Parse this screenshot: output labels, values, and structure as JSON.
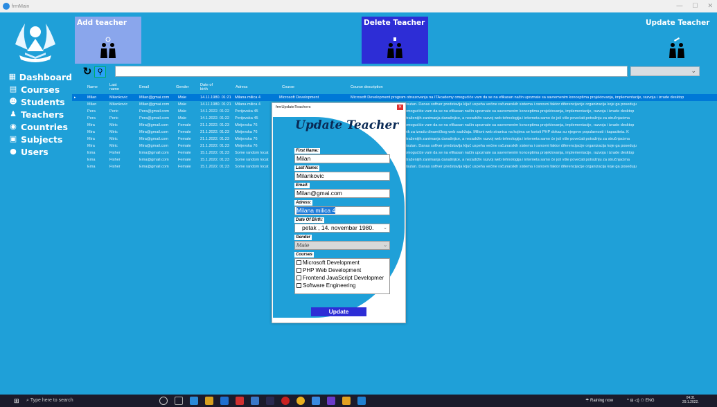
{
  "window": {
    "title": "frmMain"
  },
  "sidebar": {
    "items": [
      {
        "label": "Dashboard",
        "icon": "dashboard-icon"
      },
      {
        "label": "Courses",
        "icon": "courses-icon"
      },
      {
        "label": "Students",
        "icon": "students-icon"
      },
      {
        "label": "Teachers",
        "icon": "teachers-icon"
      },
      {
        "label": "Countries",
        "icon": "globe-icon"
      },
      {
        "label": "Subjects",
        "icon": "subjects-icon"
      },
      {
        "label": "Users",
        "icon": "user-icon"
      }
    ]
  },
  "toolbar": {
    "add_label": "Add teacher",
    "delete_label": "Delete Teacher",
    "update_label": "Update Teacher"
  },
  "grid": {
    "columns": [
      "Name",
      "Last name",
      "Email",
      "Gender",
      "Date of birth",
      "Adress",
      "Course",
      "Course description"
    ],
    "rows": [
      [
        "Milan",
        "Milankovic",
        "Milan@gmai.com",
        "Male",
        "14.11.1980. 01:21",
        "Milana milica 4",
        "Microsoft Development",
        "Microsoft Development program obrazovanja na ITAcademy omogućiće vam da se na efikasan način upoznate sa savremenim konceptima projektovanja, implementacije, razvoja i izrade desktop"
      ],
      [
        "Milan",
        "Milankovic",
        "Milan@gmai.com",
        "Male",
        "14.11.1980. 01:21",
        "Milana milica 4",
        "",
        "e praktično neizbežan i svuda prisutan. Danas softver predstavlja ključ uspeha većine računarskih sistema i osnovni faktor diferencijacije organizacija koje ga poseduju"
      ],
      [
        "Pera",
        "Peric",
        "Pera@gmail.com",
        "Male",
        "14.1.2022. 01:22",
        "Perijevska 45",
        "",
        "am obrazovanja na ITAcademy omogućiće vam da se na efikasan način upoznate sa savremenim konceptima projektovanja, implementacije, razvoja i izrade desktop"
      ],
      [
        "Pera",
        "Peric",
        "Pera@gmail.com",
        "Male",
        "14.1.2022. 01:22",
        "Perijevska 45",
        "",
        "a i web aplikacija jedno je od najtraženijih zanimanja današnjice, a nezadrživ razvoj web tehnologija i interneta samo će još više povećati potražnju za stručnjacima"
      ],
      [
        "Mira",
        "Miric",
        "Mira@gmail.com",
        "Female",
        "21.1.2022. 01:23",
        "Mirijevska 76",
        "",
        "am obrazovanja na ITAcademy omogućiće vam da se na efikasan način upoznate sa savremenim konceptima projektovanja, implementacije, razvoja i izrade desktop"
      ],
      [
        "Mira",
        "Miric",
        "Mira@gmail.com",
        "Female",
        "21.1.2022. 01:23",
        "Mirijevska 76",
        "",
        "eno moćan Script programski jezik za izradu dinamičkog web sadržaja. Milioni web stranica na kojima se koristi PHP dokaz su njegove popularnosti i kapaciteta. K"
      ],
      [
        "Mira",
        "Miric",
        "Mira@gmail.com",
        "Female",
        "21.1.2022. 01:23",
        "Mirijevska 76",
        "",
        "a i web aplikacija jedno je od najtraženijih zanimanja današnjice, a nezadrživ razvoj web tehnologija i interneta samo će još više povećati potražnju za stručnjacima"
      ],
      [
        "Mira",
        "Miric",
        "Mira@gmail.com",
        "Female",
        "21.1.2022. 01:23",
        "Mirijevska 76",
        "",
        "e praktično neizbežan i svuda prisutan. Danas softver predstavlja ključ uspeha većine računarskih sistema i osnovni faktor diferencijacije organizacija koje ga poseduju"
      ],
      [
        "Ema",
        "Fisher",
        "Ema@gmail.com",
        "Female",
        "15.1.2022. 01:23",
        "Some random locat",
        "",
        "am obrazovanja na ITAcademy omogućiće vam da se na efikasan način upoznate sa savremenim konceptima projektovanja, implementacije, razvoja i izrade desktop"
      ],
      [
        "Ema",
        "Fisher",
        "Ema@gmail.com",
        "Female",
        "15.1.2022. 01:23",
        "Some random locat",
        "",
        "a i web aplikacija jedno je od najtraženijih zanimanja današnjice, a nezadrživ razvoj web tehnologija i interneta samo će još više povećati potražnju za stručnjacima"
      ],
      [
        "Ema",
        "Fisher",
        "Ema@gmail.com",
        "Female",
        "15.1.2022. 01:23",
        "Some random locat",
        "",
        "e praktično neizbežan i svuda prisutan. Danas softver predstavlja ključ uspeha većine računarskih sistema i osnovni faktor diferencijacije organizacija koje ga poseduju"
      ]
    ]
  },
  "dialog": {
    "title": "frmUpdateTeachers",
    "heading": "Update Teacher",
    "first_name_label": "First Name:",
    "first_name": "Milan",
    "last_name_label": "Last Name:",
    "last_name": "Milankovic",
    "email_label": "Email:",
    "email": "Milan@gmai.com",
    "adress_label": "Adress:",
    "adress": "Milana milica 4",
    "dob_label": "Date Of Birth:",
    "dob": "petak    , 14. novembar 1980.",
    "gender_label": "Gender",
    "gender": "Male",
    "courses_label": "Courses",
    "courses": [
      "Microsoft Development",
      "PHP Web Development",
      "Frontend JavaScript Developmer",
      "Software Engineering"
    ],
    "update_label": "Update"
  },
  "taskbar": {
    "search_placeholder": "Type here to search",
    "weather": "Raining now",
    "lang": "ENG",
    "time": "04:31",
    "date": "29.1.2022."
  },
  "colors": {
    "accent": "#1fa0d8",
    "selection": "#0078d7",
    "button_dark": "#2d2dd6",
    "button_light": "#8aa6ec"
  }
}
